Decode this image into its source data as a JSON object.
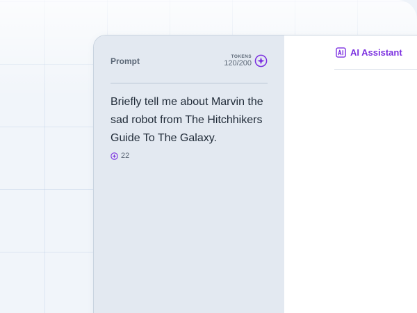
{
  "prompt": {
    "title": "Prompt",
    "tokens_label": "TOKENS",
    "tokens_count": "120/200",
    "text": "Briefly tell me about Marvin the sad robot from The Hitchhikers Guide To The Galaxy.",
    "token_usage": "22"
  },
  "assistant": {
    "tab_label": "AI Assistant"
  },
  "colors": {
    "accent": "#7b2fe0",
    "panel": "#e3e9f1"
  }
}
